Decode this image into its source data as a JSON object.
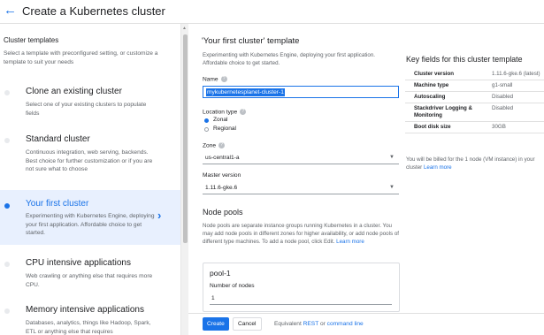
{
  "header": {
    "back_icon": "←",
    "title": "Create a Kubernetes cluster"
  },
  "sidebar": {
    "heading": "Cluster templates",
    "subtitle": "Select a template with preconfigured setting, or customize a template to suit your needs",
    "templates": [
      {
        "title": "Clone an existing cluster",
        "description": "Select one of your existing clusters to populate fields"
      },
      {
        "title": "Standard cluster",
        "description": "Continuous integration, web serving, backends. Best choice for further customization or if you are not sure what to choose"
      },
      {
        "title": "Your first cluster",
        "description": "Experimenting with Kubernetes Engine, deploying your first application. Affordable choice to get started.",
        "selected": true
      },
      {
        "title": "CPU intensive applications",
        "description": "Web crawling or anything else that requires more CPU."
      },
      {
        "title": "Memory intensive applications",
        "description": "Databases, analytics, things like Hadoop, Spark, ETL or anything else that requires"
      }
    ],
    "selected_chevron": "›"
  },
  "form": {
    "title": "'Your first cluster' template",
    "subtitle": "Experimenting with Kubernetes Engine, deploying your first application. Affordable choice to get started.",
    "name_label": "Name",
    "name_value": "mykubernetesplanet-cluster-1",
    "location_label": "Location type",
    "location_options": [
      "Zonal",
      "Regional"
    ],
    "location_selected": "Zonal",
    "zone_label": "Zone",
    "zone_value": "us-central1-a",
    "master_label": "Master version",
    "master_value": "1.11.6-gke.6",
    "help_icon": "?",
    "dropdown_icon": "▼",
    "node_pools_title": "Node pools",
    "node_pools_desc": "Node pools are separate instance groups running Kubernetes in a cluster. You may add node pools in different zones for higher availability, or add node pools of different type machines. To add a node pool, click Edit.",
    "node_pools_link": "Learn more",
    "pool_name": "pool-1",
    "nodes_label": "Number of nodes",
    "nodes_value": "1"
  },
  "actions": {
    "create_label": "Create",
    "cancel_label": "Cancel",
    "equivalent_prefix": "Equivalent",
    "rest_link": "REST",
    "or_text": "or",
    "cli_link": "command line"
  },
  "key_fields": {
    "title": "Key fields for this cluster template",
    "rows": [
      {
        "key": "Cluster version",
        "value": "1.11.6-gke.6 (latest)"
      },
      {
        "key": "Machine type",
        "value": "g1-small"
      },
      {
        "key": "Autoscaling",
        "value": "Disabled"
      },
      {
        "key": "Stackdriver Logging & Monitoring",
        "value": "Disabled"
      },
      {
        "key": "Boot disk size",
        "value": "30GB"
      }
    ],
    "billing_note": "You will be billed for the 1 node (VM instance) in your cluster",
    "billing_link": "Learn more"
  },
  "colors": {
    "accent": "#1a73e8",
    "selected_bg": "#e8f0fe",
    "muted_text": "#5f6368"
  }
}
